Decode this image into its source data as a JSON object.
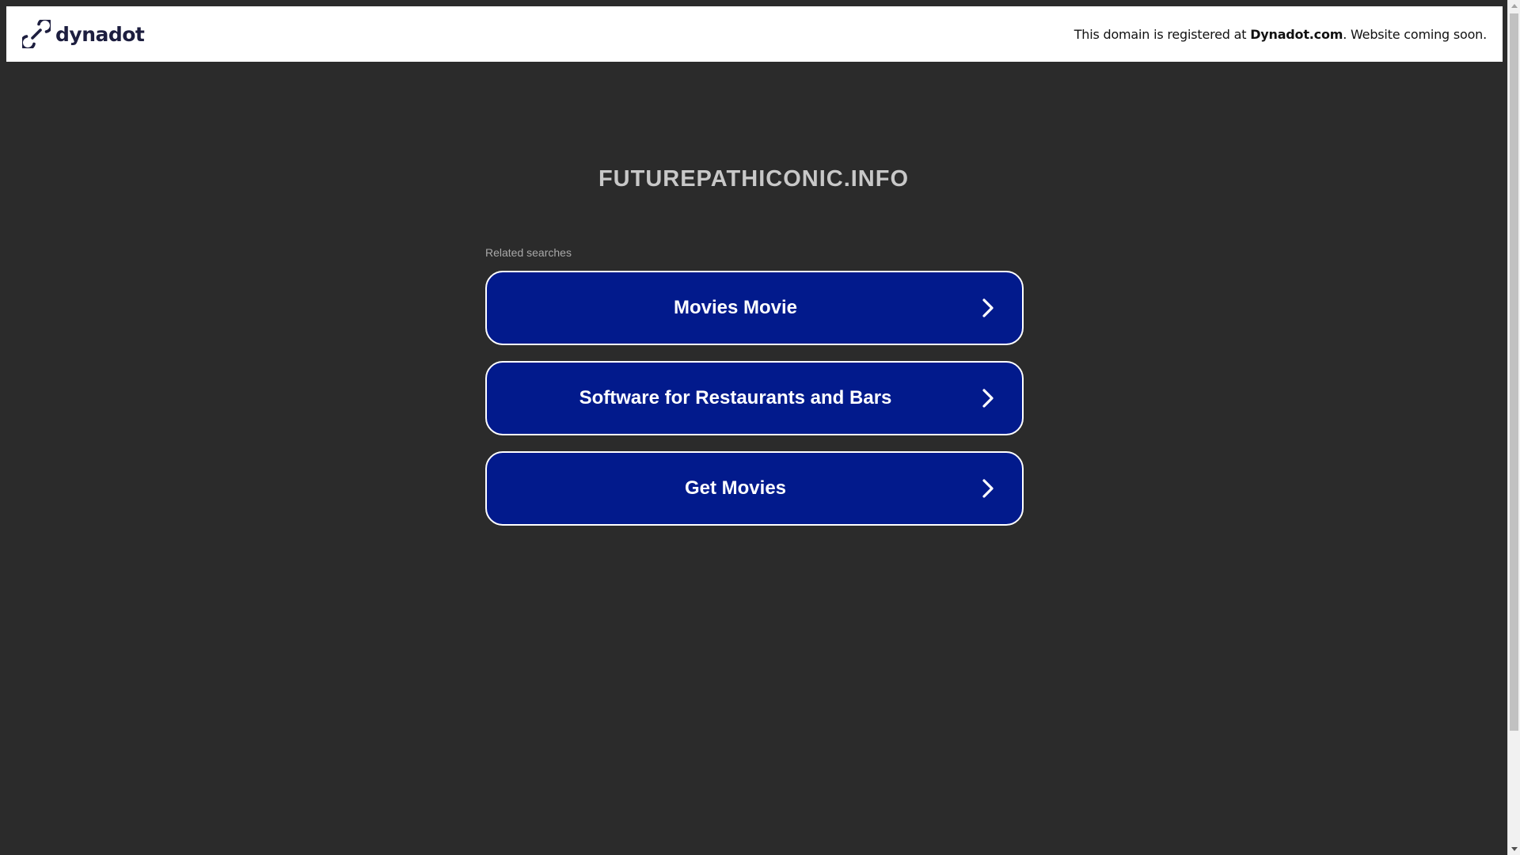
{
  "header": {
    "brand_name": "dynadot",
    "message_prefix": "This domain is registered at ",
    "message_link": "Dynadot.com",
    "message_suffix": ". Website coming soon."
  },
  "main": {
    "domain": "FUTUREPATHICONIC.INFO",
    "related_label": "Related searches",
    "searches": [
      {
        "label": "Movies Movie"
      },
      {
        "label": "Software for Restaurants and Bars"
      },
      {
        "label": "Get Movies"
      }
    ]
  },
  "colors": {
    "background": "#2b2b2b",
    "button": "#021a8c",
    "brand": "#1d1e3f"
  }
}
